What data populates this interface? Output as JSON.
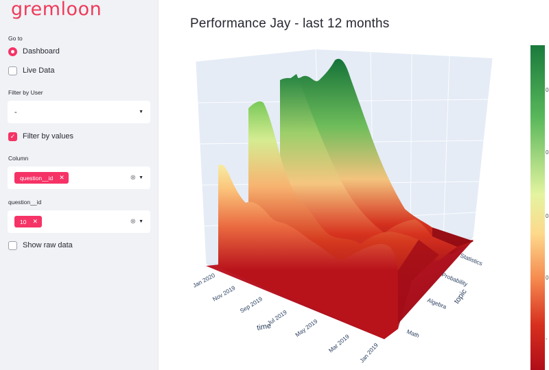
{
  "app": {
    "logo": "gremloon"
  },
  "sidebar": {
    "goto_label": "Go to",
    "nav_options": [
      {
        "label": "Dashboard",
        "selected": true
      },
      {
        "label": "Live Data",
        "selected": false
      }
    ],
    "filter_user": {
      "label": "Filter by User",
      "value": "-"
    },
    "filter_by_values": {
      "label": "Filter by values",
      "checked": true
    },
    "column": {
      "label": "Column",
      "tag": "question__id"
    },
    "question_id": {
      "label": "question__id",
      "tag": "10"
    },
    "show_raw": {
      "label": "Show raw data",
      "checked": false
    }
  },
  "main": {
    "title": "Performance Jay - last 12 months",
    "xaxis": {
      "title": "time",
      "ticks": [
        "Jan 2020",
        "Nov 2019",
        "Sep 2019",
        "Jul 2019",
        "May 2019",
        "Mar 2019",
        "Jan 2019"
      ]
    },
    "yaxis": {
      "title": "topic",
      "ticks": [
        "Math",
        "Algebra",
        "Probability",
        "Statistics"
      ]
    },
    "colorbar_ticks": [
      "0",
      "0",
      "0",
      "0",
      "0",
      "-"
    ]
  },
  "colors": {
    "accent": "#f63366",
    "logo": "#ef3b5a",
    "sidebar_bg": "#f0f2f6",
    "scene_bg": "#e5ecf6"
  }
}
